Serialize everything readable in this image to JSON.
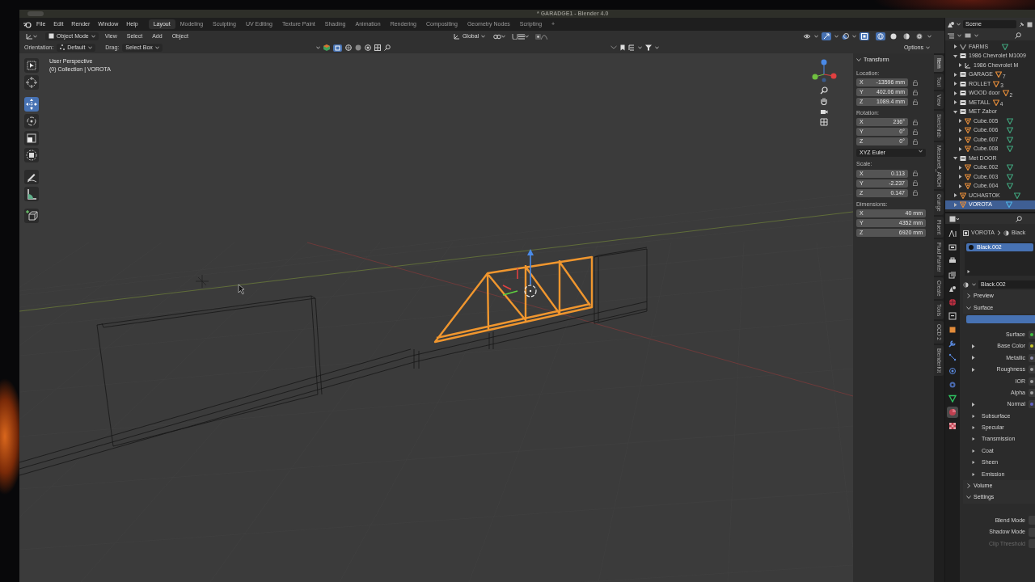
{
  "window": {
    "title": "* GARADGE1 - Blender 4.0"
  },
  "menus": [
    "File",
    "Edit",
    "Render",
    "Window",
    "Help"
  ],
  "workspaces": [
    {
      "label": "Layout",
      "selected": true
    },
    {
      "label": "Modeling",
      "selected": false
    },
    {
      "label": "Sculpting",
      "selected": false
    },
    {
      "label": "UV Editing",
      "selected": false
    },
    {
      "label": "Texture Paint",
      "selected": false
    },
    {
      "label": "Shading",
      "selected": false
    },
    {
      "label": "Animation",
      "selected": false
    },
    {
      "label": "Rendering",
      "selected": false
    },
    {
      "label": "Compositing",
      "selected": false
    },
    {
      "label": "Geometry Nodes",
      "selected": false
    },
    {
      "label": "Scripting",
      "selected": false
    }
  ],
  "add_workspace": "+",
  "header": {
    "mode": "Object Mode",
    "menus": [
      "View",
      "Select",
      "Add",
      "Object"
    ],
    "orientation": "Global",
    "xray": true,
    "shading": [
      {
        "kind": "wireframe",
        "selected": true
      },
      {
        "kind": "solid",
        "selected": false
      },
      {
        "kind": "material",
        "selected": false
      },
      {
        "kind": "rendered",
        "selected": false
      }
    ]
  },
  "tool_settings": {
    "orientation_label": "Orientation:",
    "orientation": "Default",
    "drag_label": "Drag:",
    "drag": "Select Box",
    "options": "Options"
  },
  "toolbar": [
    {
      "kind": "select",
      "selected": false
    },
    {
      "kind": "cursor",
      "selected": false
    },
    {
      "kind": "move",
      "selected": true
    },
    {
      "kind": "rotate",
      "selected": false
    },
    {
      "kind": "scale",
      "selected": false
    },
    {
      "kind": "transform",
      "selected": false
    },
    {
      "kind": "annotate",
      "selected": false
    },
    {
      "kind": "measure",
      "selected": false
    },
    {
      "kind": "add-cube",
      "selected": false
    }
  ],
  "viewport": {
    "view_name": "User Perspective",
    "collection": "(0) Collection | VOROTA"
  },
  "transform": {
    "title": "Transform",
    "expanded": true,
    "groups": [
      {
        "label": "Location:",
        "locks": true,
        "fields": [
          {
            "axis": "X",
            "value": "-13596 mm"
          },
          {
            "axis": "Y",
            "value": "402.06 mm"
          },
          {
            "axis": "Z",
            "value": "1089.4 mm"
          }
        ]
      },
      {
        "label": "Rotation:",
        "locks": true,
        "mode": "XYZ Euler",
        "fields": [
          {
            "axis": "X",
            "value": "236°"
          },
          {
            "axis": "Y",
            "value": "0°"
          },
          {
            "axis": "Z",
            "value": "0°"
          }
        ]
      },
      {
        "label": "Scale:",
        "locks": true,
        "fields": [
          {
            "axis": "X",
            "value": "0.113"
          },
          {
            "axis": "Y",
            "value": "-2.237"
          },
          {
            "axis": "Z",
            "value": "0.147"
          }
        ]
      },
      {
        "label": "Dimensions:",
        "locks": false,
        "fields": [
          {
            "axis": "X",
            "value": "40 mm"
          },
          {
            "axis": "Y",
            "value": "4352 mm"
          },
          {
            "axis": "Z",
            "value": "6920 mm"
          }
        ]
      }
    ]
  },
  "sidebar_tabs": [
    {
      "label": "Item",
      "selected": true
    },
    {
      "label": "Tool",
      "selected": false
    },
    {
      "label": "View",
      "selected": false
    },
    {
      "label": "Sketchfab",
      "selected": false
    },
    {
      "label": "MeasureIt_ARCH",
      "selected": false
    },
    {
      "label": "Grunge",
      "selected": false
    },
    {
      "label": "Fluent",
      "selected": false
    },
    {
      "label": "Fluid Painter",
      "selected": false
    },
    {
      "label": "Create",
      "selected": false
    },
    {
      "label": "Tools",
      "selected": false
    },
    {
      "label": "OCD 2",
      "selected": false
    },
    {
      "label": "BlenderKit",
      "selected": false
    }
  ],
  "outliner": {
    "scene": "Scene",
    "items": [
      {
        "kind": "object",
        "name": "FARMS",
        "selected": false,
        "expanded": false
      },
      {
        "kind": "collection",
        "name": "1986 Chevrolet M1009",
        "selected": false,
        "expanded": true,
        "children": [
          {
            "kind": "empty",
            "name": "1986 Chevrolet M",
            "selected": false,
            "expanded": false
          }
        ]
      },
      {
        "kind": "collection",
        "name": "GARAGE",
        "count": "7",
        "selected": false,
        "expanded": false
      },
      {
        "kind": "collection",
        "name": "ROLLET",
        "count": "3",
        "selected": false,
        "expanded": false
      },
      {
        "kind": "collection",
        "name": "WOOD door",
        "count": "2",
        "selected": false,
        "expanded": false
      },
      {
        "kind": "collection",
        "name": "METALL",
        "count": "4",
        "selected": false,
        "expanded": false
      },
      {
        "kind": "collection",
        "name": "MET Zabor",
        "selected": false,
        "expanded": true,
        "children": [
          {
            "kind": "mesh",
            "name": "Cube.005",
            "selected": false,
            "expanded": false
          },
          {
            "kind": "mesh",
            "name": "Cube.006",
            "selected": false,
            "expanded": false
          },
          {
            "kind": "mesh",
            "name": "Cube.007",
            "selected": false,
            "expanded": false
          },
          {
            "kind": "mesh",
            "name": "Cube.008",
            "selected": false,
            "expanded": false
          }
        ]
      },
      {
        "kind": "collection",
        "name": "Met DOOR",
        "selected": false,
        "expanded": true,
        "children": [
          {
            "kind": "mesh",
            "name": "Cube.002",
            "selected": false,
            "expanded": false
          },
          {
            "kind": "mesh",
            "name": "Cube.003",
            "selected": false,
            "expanded": false
          },
          {
            "kind": "mesh",
            "name": "Cube.004",
            "selected": false,
            "expanded": false
          }
        ]
      },
      {
        "kind": "mesh",
        "name": "UCHASTOK",
        "selected": false,
        "expanded": false
      },
      {
        "kind": "mesh",
        "name": "VOROTA",
        "selected": true,
        "expanded": false
      }
    ]
  },
  "properties": {
    "tabs": [
      {
        "kind": "tool",
        "selected": false
      },
      {
        "kind": "render",
        "selected": false
      },
      {
        "kind": "output",
        "selected": false
      },
      {
        "kind": "view-layer",
        "selected": false
      },
      {
        "kind": "scene",
        "selected": false
      },
      {
        "kind": "world",
        "selected": false
      },
      {
        "kind": "collection",
        "selected": false
      },
      {
        "kind": "object",
        "selected": false
      },
      {
        "kind": "modifiers",
        "selected": false
      },
      {
        "kind": "particles",
        "selected": false
      },
      {
        "kind": "physics",
        "selected": false
      },
      {
        "kind": "constraints",
        "selected": false
      },
      {
        "kind": "data",
        "selected": false
      },
      {
        "kind": "material",
        "selected": true
      },
      {
        "kind": "texture",
        "selected": false
      }
    ],
    "object": "VOROTA",
    "material_crumb": "Black",
    "slots": [
      {
        "name": "Black.002",
        "selected": true
      }
    ],
    "material": "Black.002",
    "rows": [
      {
        "kind": "panel",
        "label": "Preview",
        "expanded": false
      },
      {
        "kind": "panel",
        "label": "Surface",
        "expanded": true
      },
      {
        "kind": "node"
      },
      {
        "kind": "socket",
        "label": "Surface",
        "color": "#3fbf3f",
        "expandable": false
      },
      {
        "kind": "socket",
        "label": "Base Color",
        "color": "#c7c729",
        "expandable": true
      },
      {
        "kind": "socket",
        "label": "Metallic",
        "color": "#8a8aa8",
        "expandable": true
      },
      {
        "kind": "socket",
        "label": "Roughness",
        "color": "#a1a1a1",
        "expandable": true
      },
      {
        "kind": "socket",
        "label": "IOR",
        "color": "#a1a1a1",
        "expandable": false
      },
      {
        "kind": "socket",
        "label": "Alpha",
        "color": "#a1a1a1",
        "expandable": false
      },
      {
        "kind": "socket",
        "label": "Normal",
        "color": "#6363c7",
        "expandable": true
      },
      {
        "kind": "subpanel",
        "label": "Subsurface"
      },
      {
        "kind": "subpanel",
        "label": "Specular"
      },
      {
        "kind": "subpanel",
        "label": "Transmission"
      },
      {
        "kind": "subpanel",
        "label": "Coat"
      },
      {
        "kind": "subpanel",
        "label": "Sheen"
      },
      {
        "kind": "subpanel",
        "label": "Emission"
      },
      {
        "kind": "panel",
        "label": "Volume",
        "expanded": false
      },
      {
        "kind": "panel",
        "label": "Settings",
        "expanded": true
      },
      {
        "kind": "setting",
        "label": "Blend Mode",
        "disabled": false
      },
      {
        "kind": "setting",
        "label": "Shadow Mode",
        "disabled": false
      },
      {
        "kind": "setting",
        "label": "Clip Threshold",
        "disabled": true
      }
    ]
  }
}
